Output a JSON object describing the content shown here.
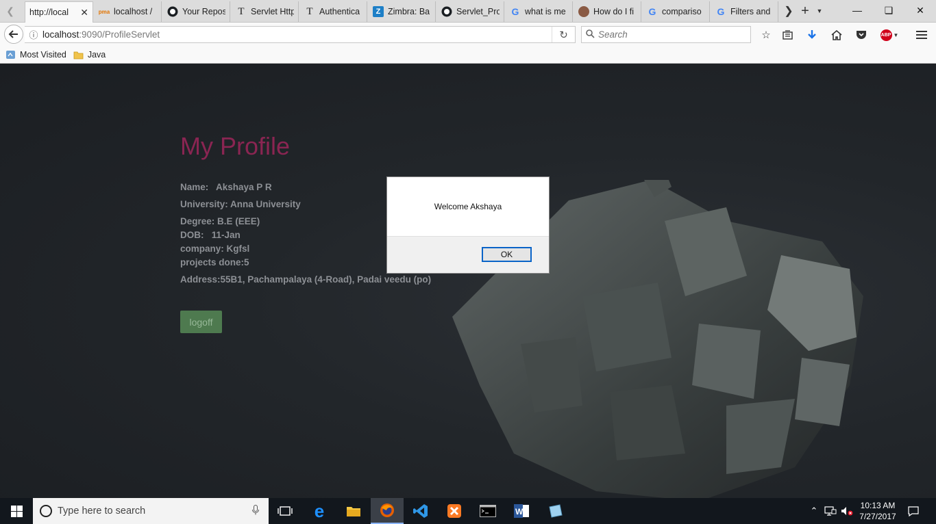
{
  "browser": {
    "tabs": [
      {
        "label": "http://local",
        "active": true,
        "icon": "page-icon"
      },
      {
        "label": "localhost /",
        "icon": "phpmyadmin-icon"
      },
      {
        "label": "Your Repos",
        "icon": "github-icon"
      },
      {
        "label": "Servlet Http",
        "icon": "t-icon"
      },
      {
        "label": "Authentica",
        "icon": "t-icon"
      },
      {
        "label": "Zimbra: Ba",
        "icon": "zimbra-icon"
      },
      {
        "label": "Servlet_Pro",
        "icon": "github-icon"
      },
      {
        "label": "what is me",
        "icon": "google-icon"
      },
      {
        "label": "How do I fi",
        "icon": "user-icon"
      },
      {
        "label": "compariso",
        "icon": "google-icon"
      },
      {
        "label": "Filters and",
        "icon": "google-icon"
      }
    ],
    "url_host": "localhost",
    "url_rest": ":9090/ProfileServlet",
    "search_placeholder": "Search",
    "bookmarks": [
      {
        "label": "Most Visited",
        "icon": "most-visited-icon"
      },
      {
        "label": "Java",
        "icon": "folder-icon"
      }
    ],
    "abp_text": "ABP"
  },
  "profile": {
    "title": "My Profile",
    "name": "Name:   Akshaya P R",
    "university": "University: Anna University",
    "degree": "Degree: B.E (EEE)",
    "dob": "DOB:   11-Jan",
    "company": "company: Kgfsl",
    "projects": "projects done:5",
    "address": "Address:55B1, Pachampalaya (4-Road), Padai veedu (po)",
    "logoff_label": "logoff"
  },
  "dialog": {
    "message": "Welcome Akshaya",
    "ok_label": "OK"
  },
  "taskbar": {
    "search_placeholder": "Type here to search",
    "time": "10:13 AM",
    "date": "7/27/2017"
  },
  "colors": {
    "title": "#8a2552",
    "logoff_bg": "#4e7a4f",
    "field_text": "#8d9095"
  }
}
